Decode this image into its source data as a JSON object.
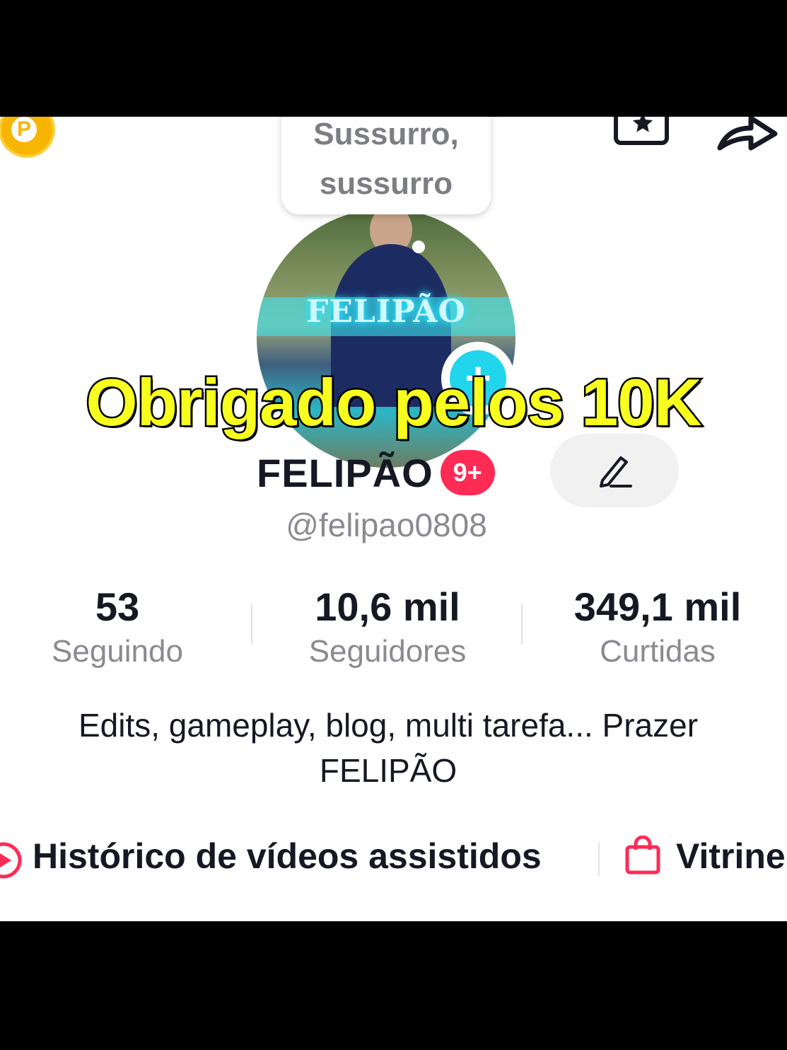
{
  "bubble": {
    "line1": "Sussurro,",
    "line2": "sussurro"
  },
  "avatar": {
    "overlay_text": "FELIPÃO"
  },
  "overlay_caption": "Obrigado pelos 10K",
  "profile": {
    "name": "FELIPÃO",
    "badge": "9+",
    "handle": "@felipao0808",
    "bio_line1": "Edits, gameplay, blog, multi tarefa... Prazer",
    "bio_line2": "FELIPÃO"
  },
  "stats": [
    {
      "value": "53",
      "label": "Seguindo"
    },
    {
      "value": "10,6 mil",
      "label": "Seguidores"
    },
    {
      "value": "349,1 mil",
      "label": "Curtidas"
    }
  ],
  "links": {
    "history": "Histórico de vídeos assistidos",
    "showcase": "Vitrine"
  },
  "icons": [
    "coin-icon",
    "favorites-icon",
    "share-icon",
    "add-icon",
    "edit-icon",
    "play-icon",
    "shopping-bag-icon"
  ],
  "colors": {
    "accent": "#fe2c55",
    "add": "#20d5ec",
    "caption": "#f7ff1f",
    "coin": "#f7b500"
  }
}
